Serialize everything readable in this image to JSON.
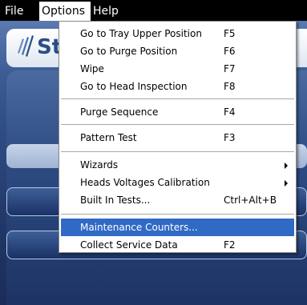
{
  "menubar": {
    "items": [
      "File",
      "Options",
      "Help"
    ],
    "active": "Options"
  },
  "app": {
    "logo_text": "St"
  },
  "options_menu": {
    "items": [
      {
        "label": "Go to Tray Upper Position",
        "shortcut": "F5"
      },
      {
        "label": "Go to Purge Position",
        "shortcut": "F6"
      },
      {
        "label": "Wipe",
        "shortcut": "F7"
      },
      {
        "label": "Go to Head Inspection",
        "shortcut": "F8"
      },
      {
        "label": "Purge Sequence",
        "shortcut": "F4"
      },
      {
        "label": "Pattern Test",
        "shortcut": "F3"
      },
      {
        "label": "Wizards",
        "submenu": true
      },
      {
        "label": "Heads Voltages Calibration",
        "submenu": true
      },
      {
        "label": "Built In Tests...",
        "shortcut": "Ctrl+Alt+B"
      },
      {
        "label": "Maintenance Counters...",
        "highlighted": true
      },
      {
        "label": "Collect Service Data",
        "shortcut": "F2"
      }
    ]
  },
  "colors": {
    "menu_highlight": "#316ac5",
    "menubar_bg": "#000000",
    "app_bg": "#34538a",
    "logo_text": "#2b4d87"
  }
}
